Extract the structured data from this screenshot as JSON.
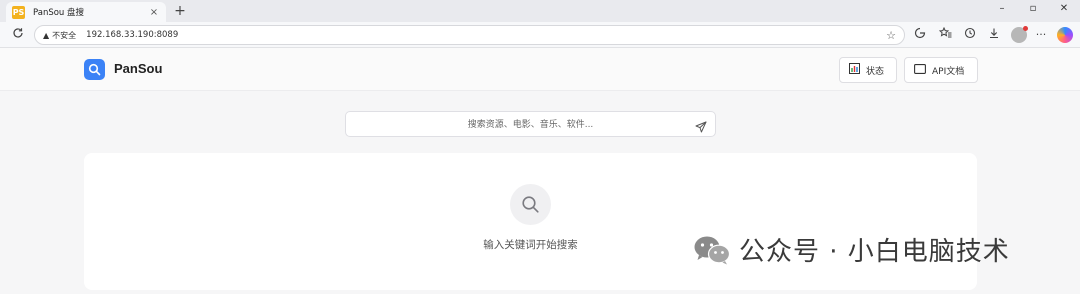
{
  "browser": {
    "tab_title": "PanSou 盘搜",
    "tab_favicon_text": "PS",
    "tab_close": "×",
    "new_tab": "+",
    "window_controls": {
      "minimize": "–",
      "maximize": "▫",
      "close": "✕"
    },
    "back": "C",
    "not_secure_label": "不安全",
    "warn_glyph": "▲",
    "url": "192.168.33.190:8089"
  },
  "site": {
    "brand": "PanSou",
    "status_label": "状态",
    "api_label": "API文档"
  },
  "search": {
    "placeholder": "搜索资源、电影、音乐、软件..."
  },
  "results": {
    "empty_text": "输入关键词开始搜索"
  },
  "watermark": {
    "text": "公众号 · 小白电脑技术"
  },
  "colors": {
    "accent": "#3b82f6",
    "favicon": "#f3b21f"
  }
}
